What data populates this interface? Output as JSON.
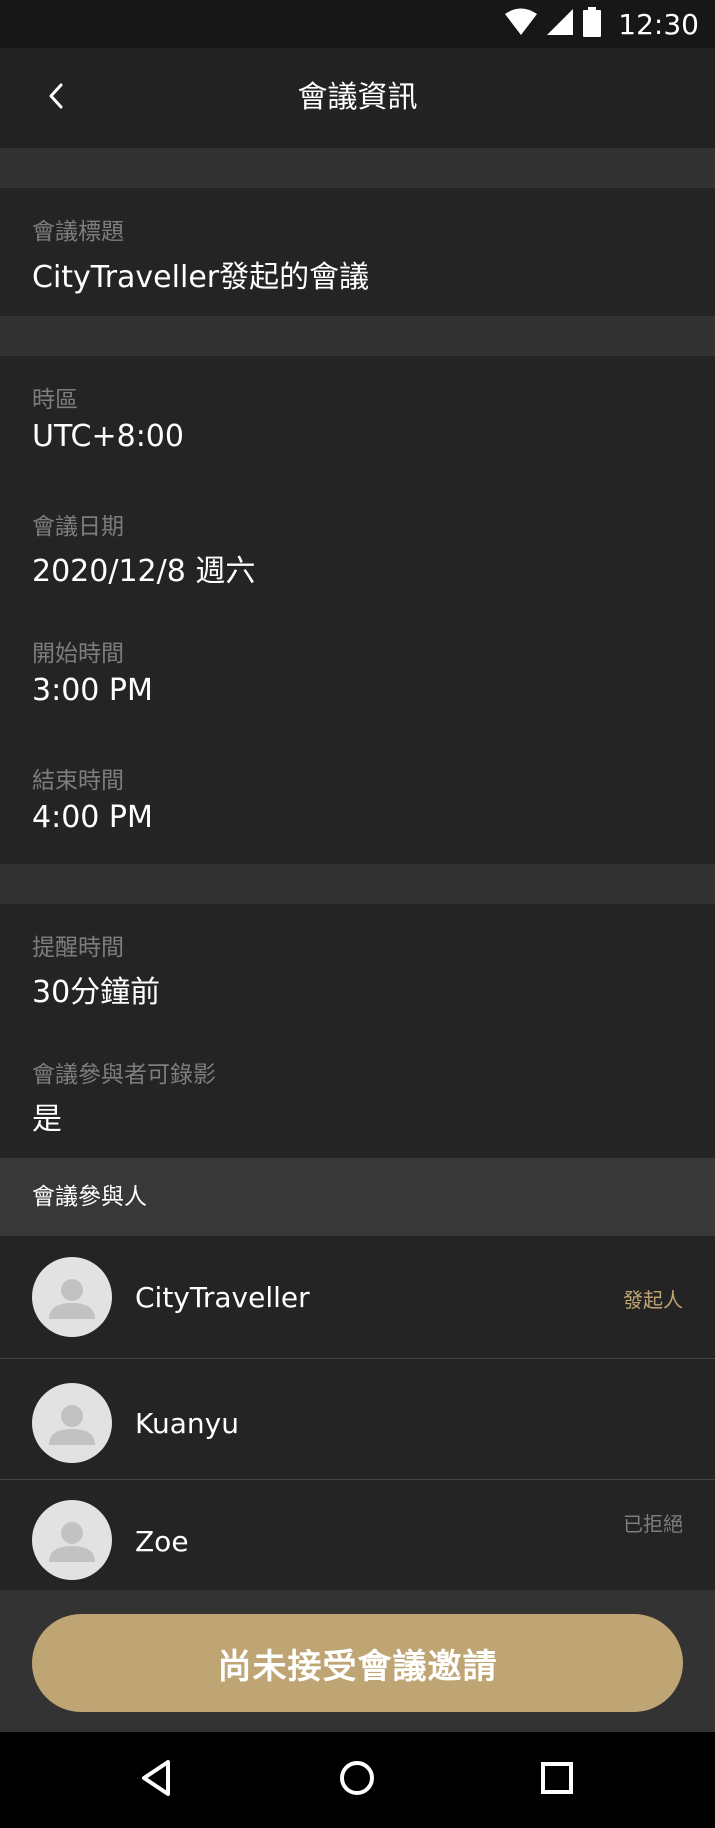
{
  "status_bar": {
    "time": "12:30",
    "icons": [
      "wifi-icon",
      "cell-signal-icon",
      "battery-icon"
    ]
  },
  "app_bar": {
    "title": "會議資訊",
    "back_icon": "chevron-left-icon"
  },
  "meeting_title": {
    "label": "會議標題",
    "value": "CityTraveller發起的會議"
  },
  "schedule": {
    "timezone_label": "時區",
    "timezone_value": "UTC+8:00",
    "date_label": "會議日期",
    "date_value": "2020/12/8 週六",
    "start_label": "開始時間",
    "start_value": "3:00 PM",
    "end_label": "結束時間",
    "end_value": "4:00 PM"
  },
  "options": {
    "reminder_label": "提醒時間",
    "reminder_value": "30分鐘前",
    "recording_label": "會議參與者可錄影",
    "recording_value": "是"
  },
  "participants": {
    "header": "會議參與人",
    "items": [
      {
        "name": "CityTraveller",
        "tag": "發起人"
      },
      {
        "name": "Kuanyu",
        "tag": ""
      },
      {
        "name": "Zoe",
        "tag": "已拒絕"
      }
    ]
  },
  "footer": {
    "button_label": "尚未接受會議邀請"
  },
  "nav_bar": {
    "icons": [
      "back-triangle-icon",
      "home-circle-icon",
      "recents-square-icon"
    ]
  },
  "colors": {
    "accent": "#bfa574",
    "background": "#242424",
    "separator": "#323232",
    "label": "#7d7d7d",
    "declined": "#7d7d7d"
  }
}
